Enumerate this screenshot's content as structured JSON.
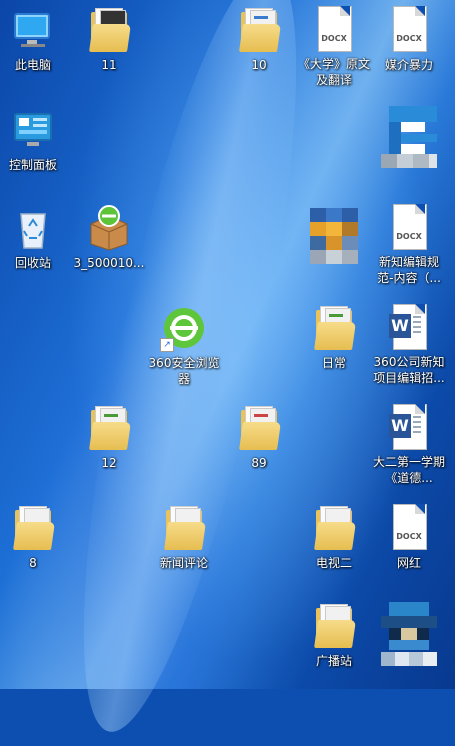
{
  "desktop": {
    "icons": [
      {
        "id": "this-pc",
        "label": "此电脑",
        "icon": "computer-icon"
      },
      {
        "id": "folder-11",
        "label": "11",
        "icon": "folder-icon"
      },
      {
        "id": "folder-10",
        "label": "10",
        "icon": "folder-icon"
      },
      {
        "id": "docx-daxue",
        "label": "《大学》原文及翻译",
        "icon": "docx-file-icon"
      },
      {
        "id": "docx-meijie",
        "label": "媒介暴力",
        "icon": "docx-file-icon"
      },
      {
        "id": "control-panel",
        "label": "控制面板",
        "icon": "control-panel-icon"
      },
      {
        "id": "pixelated-1",
        "label": "",
        "icon": "blurred-app-icon"
      },
      {
        "id": "recycle-bin",
        "label": "回收站",
        "icon": "recycle-bin-icon"
      },
      {
        "id": "installer-360",
        "label": "3_500010...",
        "icon": "package-installer-icon"
      },
      {
        "id": "pixelated-2",
        "label": "",
        "icon": "blurred-app-icon"
      },
      {
        "id": "docx-xinzhi",
        "label": "新知编辑规范-内容（...",
        "icon": "docx-file-icon"
      },
      {
        "id": "browser-360",
        "label": "360安全浏览器",
        "icon": "360-browser-icon"
      },
      {
        "id": "folder-richang",
        "label": "日常",
        "icon": "folder-icon"
      },
      {
        "id": "word-360",
        "label": "360公司新知项目编辑招...",
        "icon": "word-document-icon"
      },
      {
        "id": "folder-12",
        "label": "12",
        "icon": "folder-icon"
      },
      {
        "id": "folder-89",
        "label": "89",
        "icon": "folder-icon"
      },
      {
        "id": "word-dayi",
        "label": "大二第一学期《道德...",
        "icon": "word-document-icon"
      },
      {
        "id": "folder-8",
        "label": "8",
        "icon": "folder-icon"
      },
      {
        "id": "folder-xinwen",
        "label": "新闻评论",
        "icon": "folder-icon"
      },
      {
        "id": "folder-dianshi",
        "label": "电视二",
        "icon": "folder-icon"
      },
      {
        "id": "docx-wanghong",
        "label": "网红",
        "icon": "docx-file-icon"
      },
      {
        "id": "folder-guangbo",
        "label": "广播站",
        "icon": "folder-icon"
      },
      {
        "id": "pixelated-3",
        "label": "",
        "icon": "blurred-app-icon"
      }
    ],
    "docx_tag": "DOCX",
    "word_letter": "W",
    "accent_color": "#0d4fb0"
  }
}
